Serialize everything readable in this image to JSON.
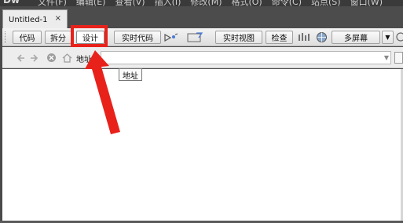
{
  "menubar": {
    "logo": "Dw",
    "menus": [
      "文件(F)",
      "编辑(E)",
      "查看(V)",
      "插入(I)",
      "修改(M)",
      "格式(O)",
      "命令(C)",
      "站点(S)",
      "窗口(W)"
    ]
  },
  "document_tab": {
    "title": "Untitled-1",
    "close": "×"
  },
  "toolbar": {
    "code": "代码",
    "split": "拆分",
    "design": "设计",
    "live_code": "实时代码",
    "live_view": "实时视图",
    "inspect": "检查",
    "multiscreen": "多屏幕"
  },
  "address_bar": {
    "label": "地址",
    "value": ""
  },
  "tooltip": "地址",
  "annotation": {
    "highlight_color": "#e8221b",
    "arrow_color": "#e8221b"
  }
}
